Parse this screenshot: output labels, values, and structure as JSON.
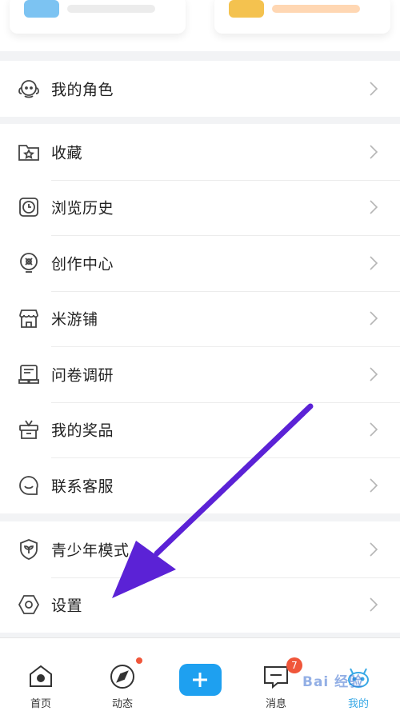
{
  "menu_group_1": [
    {
      "label": "我的角色",
      "icon": "character-icon"
    }
  ],
  "menu_group_2": [
    {
      "label": "收藏",
      "icon": "star-folder-icon"
    },
    {
      "label": "浏览历史",
      "icon": "clock-icon"
    },
    {
      "label": "创作中心",
      "icon": "bulb-icon"
    },
    {
      "label": "米游铺",
      "icon": "shop-icon"
    },
    {
      "label": "问卷调研",
      "icon": "survey-icon"
    },
    {
      "label": "我的奖品",
      "icon": "gift-icon"
    },
    {
      "label": "联系客服",
      "icon": "service-chat-icon"
    }
  ],
  "menu_group_3": [
    {
      "label": "青少年模式",
      "icon": "shield-leaf-icon"
    },
    {
      "label": "设置",
      "icon": "hexagon-gear-icon"
    }
  ],
  "tabbar": {
    "home": "首页",
    "feed": "动态",
    "messages": "消息",
    "messages_badge": "7",
    "mine": "我的"
  },
  "watermark": "Bai  经验",
  "colors": {
    "accent": "#39a9e6",
    "add_button": "#1ea0f0",
    "badge": "#f0563a",
    "arrow": "#5b22d6"
  }
}
